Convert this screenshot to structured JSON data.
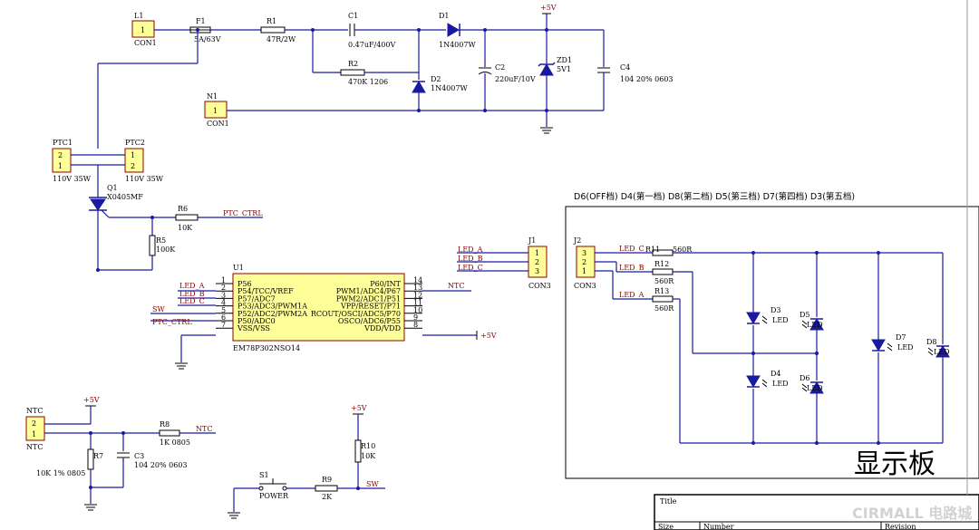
{
  "power": {
    "con1_l": "L1",
    "con1_l_sub": "CON1",
    "con1_n": "N1",
    "con1_n_sub": "CON1",
    "pin1": "1",
    "pin2": "2",
    "pin3": "3"
  },
  "vcc": "+5V",
  "f1": {
    "ref": "F1",
    "val": "5A/63V"
  },
  "r1": {
    "ref": "R1",
    "val": "47R/2W"
  },
  "c1": {
    "ref": "C1",
    "val": "0.47uF/400V"
  },
  "d1": {
    "ref": "D1",
    "val": "1N4007W"
  },
  "r2": {
    "ref": "R2",
    "val": "470K 1206"
  },
  "d2": {
    "ref": "D2",
    "val": "1N4007W"
  },
  "c2": {
    "ref": "C2",
    "val": "220uF/10V"
  },
  "zd1": {
    "ref": "ZD1",
    "val": "5V1"
  },
  "c4": {
    "ref": "C4",
    "val": "104 20% 0603"
  },
  "ptc1": {
    "ref": "PTC1",
    "val": "110V 35W"
  },
  "ptc2": {
    "ref": "PTC2",
    "val": "110V 35W"
  },
  "q1": {
    "ref": "Q1",
    "val": "X0405MF"
  },
  "r6": {
    "ref": "R6",
    "val": "10K"
  },
  "r5": {
    "ref": "R5",
    "val": "100K"
  },
  "nets": {
    "ptc_ctrl": "PTC_CTRL",
    "led_a": "LED_A",
    "led_b": "LED_B",
    "led_c": "LED_C",
    "sw": "SW",
    "ntc": "NTC"
  },
  "u1": {
    "ref": "U1",
    "part": "EM78P302NSO14",
    "left_pins": [
      {
        "num": "1",
        "name": "P56"
      },
      {
        "num": "2",
        "name": "P54/TCC/VREF"
      },
      {
        "num": "3",
        "name": "P57/ADC7"
      },
      {
        "num": "4",
        "name": "P53/ADC3/PWM1A"
      },
      {
        "num": "5",
        "name": "P52/ADC2/PWM2A"
      },
      {
        "num": "6",
        "name": "P50/ADC0"
      },
      {
        "num": "7",
        "name": "VSS/VSS"
      }
    ],
    "right_pins": [
      {
        "num": "14",
        "name": "P60/INT"
      },
      {
        "num": "13",
        "name": "PWM1/ADC4/P67"
      },
      {
        "num": "12",
        "name": "PWM2/ADC1/P51"
      },
      {
        "num": "11",
        "name": "VPP/RESET/P71"
      },
      {
        "num": "10",
        "name": "RCOUT/OSCI/ADC5/P70"
      },
      {
        "num": "9",
        "name": "OSCO/ADC6/P55"
      },
      {
        "num": "8",
        "name": "VDD/VDD"
      }
    ]
  },
  "j1": {
    "ref": "J1",
    "sub": "CON3"
  },
  "j2": {
    "ref": "J2",
    "sub": "CON3"
  },
  "display": {
    "modes": "D6(OFF档)   D4(第一档)   D8(第二档)   D5(第三档)   D7(第四档)   D3(第五档)",
    "title": "显示板",
    "r11": {
      "ref": "R11",
      "val": "560R"
    },
    "r12": {
      "ref": "R12",
      "val": "560R"
    },
    "r13": {
      "ref": "R13",
      "val": "560R"
    },
    "leds": [
      {
        "ref": "D3",
        "val": "LED"
      },
      {
        "ref": "D5",
        "val": "LED"
      },
      {
        "ref": "D4",
        "val": "LED"
      },
      {
        "ref": "D6",
        "val": "LED"
      },
      {
        "ref": "D7",
        "val": "LED"
      },
      {
        "ref": "D8",
        "val": "LED"
      }
    ]
  },
  "ntc_con": {
    "ref": "NTC",
    "sub": "NTC"
  },
  "r8": {
    "ref": "R8",
    "val": "1K 0805"
  },
  "r7": {
    "ref": "R7",
    "val": "10K 1% 0805"
  },
  "c3": {
    "ref": "C3",
    "val": "104 20% 0603"
  },
  "s1": {
    "ref": "S1",
    "val": "POWER"
  },
  "r9": {
    "ref": "R9",
    "val": "2K"
  },
  "r10": {
    "ref": "R10",
    "val": "10K"
  },
  "titleblock": {
    "title": "Title",
    "size": "Size",
    "number": "Number",
    "revision": "Revision"
  },
  "watermark": "CIRMALL 电路城"
}
